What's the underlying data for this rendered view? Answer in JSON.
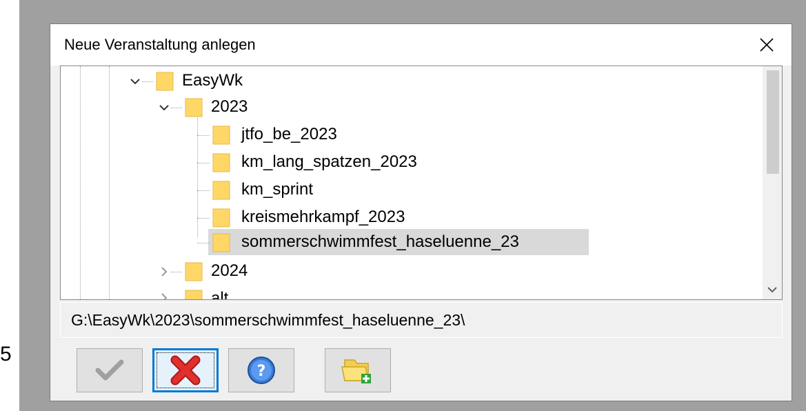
{
  "dialog": {
    "title": "Neue Veranstaltung anlegen",
    "close_label": "✕"
  },
  "tree": {
    "nodes": [
      {
        "label": "EasyWk",
        "expanded": true
      },
      {
        "label": "2023",
        "expanded": true
      },
      {
        "label": "jtfo_be_2023"
      },
      {
        "label": "km_lang_spatzen_2023"
      },
      {
        "label": "km_sprint"
      },
      {
        "label": "kreismehrkampf_2023"
      },
      {
        "label": "sommerschwimmfest_haseluenne_23",
        "selected": true
      },
      {
        "label": "2024",
        "expanded": false
      },
      {
        "label": "alt",
        "expanded": false
      }
    ]
  },
  "path": "G:\\EasyWk\\2023\\sommerschwimmfest_haseluenne_23\\",
  "toolbar": {
    "ok_icon": "checkmark-icon",
    "cancel_icon": "red-x-icon",
    "help_icon": "help-icon",
    "new_folder_icon": "new-folder-icon"
  },
  "stray_text": "5",
  "colors": {
    "selection": "#d9d9d9",
    "focus_border": "#0078d7",
    "folder": "#ffd766"
  }
}
